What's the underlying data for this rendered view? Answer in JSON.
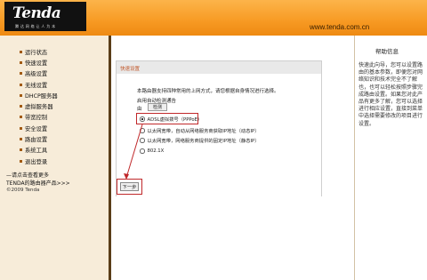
{
  "header": {
    "logo": "Tenda",
    "logo_tagline": "腾 达 网 络 让 人 为 本",
    "url": "www.tenda.com.cn"
  },
  "sidebar": {
    "items": [
      {
        "label": "运行状态"
      },
      {
        "label": "快速设置"
      },
      {
        "label": "高级设置"
      },
      {
        "label": "无线设置"
      },
      {
        "label": "DHCP服务器"
      },
      {
        "label": "虚拟服务器"
      },
      {
        "label": "带宽控制"
      },
      {
        "label": "安全设置"
      },
      {
        "label": "路由设置"
      },
      {
        "label": "系统工具"
      },
      {
        "label": "退出登录"
      }
    ],
    "more_line1": "—请点击查看更多",
    "more_line2": "TENDA的路由器产品>>>",
    "copyright": "©2009 Tenda"
  },
  "panel": {
    "title": "快速设置",
    "intro": "本路由器支持四种常用的上网方式，请您根据自身情况进行选择。",
    "auto_detect_label": "启用自动检测通告",
    "detect_prefix": "由",
    "detect_button": "检测",
    "options": [
      {
        "label": "ADSL虚拟拨号（PPPoE）",
        "checked": true
      },
      {
        "label": "以太网宽带，自动从网络服务商获取IP地址（动态IP）",
        "checked": false
      },
      {
        "label": "以太网宽带，网络服务商提供的固定IP地址（静态IP）",
        "checked": false
      },
      {
        "label": "802.1X",
        "checked": false
      }
    ],
    "next_button": "下一步"
  },
  "help": {
    "title": "帮助信息",
    "text": "快速此向导，您可以设置路由的基本参数，即便您对网络知识和技术完全不了解也，也可以轻松按照步骤完成路由设置。如果您对此产品有更多了解，您可以选择进行相应设置，直接到菜单中选择需要修改的项目进行设置。"
  },
  "colors": {
    "header_orange": "#f79a23",
    "sidebar_bg": "#f7ecd9",
    "highlight_red": "#c0282a",
    "panel_title_text": "#c0572a"
  }
}
